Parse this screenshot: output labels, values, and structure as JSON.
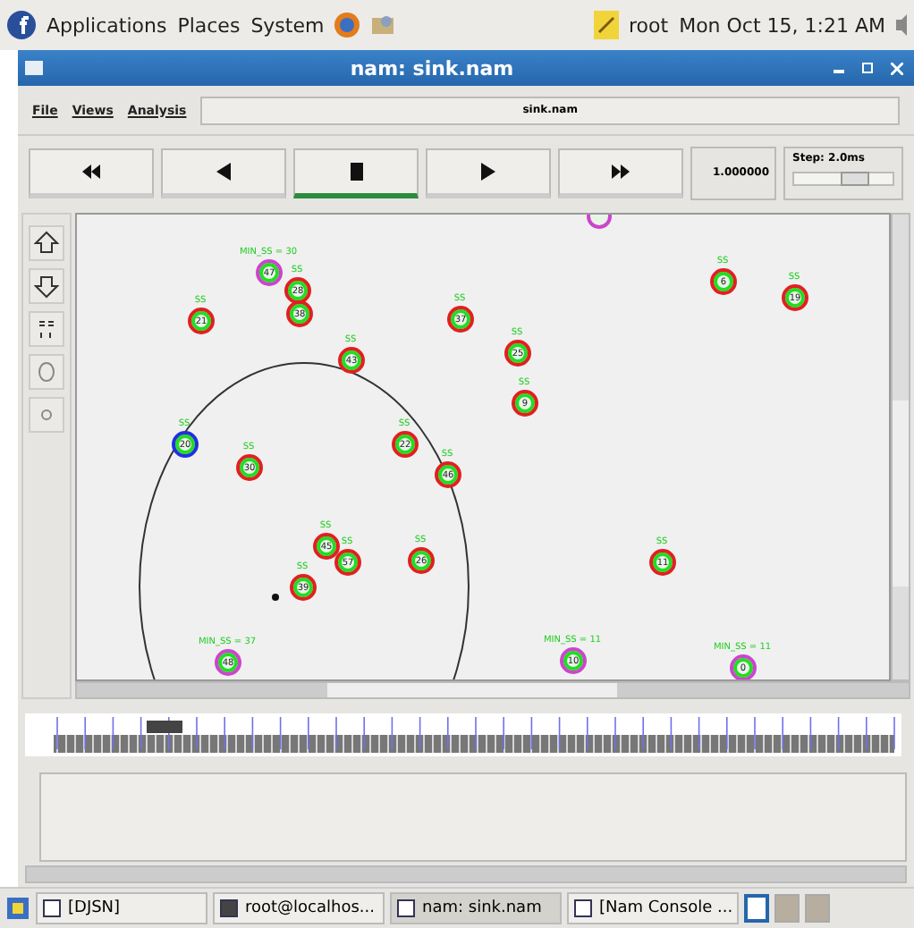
{
  "top_panel": {
    "menus": [
      "Applications",
      "Places",
      "System"
    ],
    "user": "root",
    "clock": "Mon Oct 15, 1:21 AM"
  },
  "window": {
    "title": "nam: sink.nam"
  },
  "menu": [
    "File",
    "Views",
    "Analysis"
  ],
  "file_field": "sink.nam",
  "controls": [
    {
      "kind": "rewind",
      "selected": false
    },
    {
      "kind": "back",
      "selected": false
    },
    {
      "kind": "stop",
      "selected": true
    },
    {
      "kind": "play",
      "selected": false
    },
    {
      "kind": "forward",
      "selected": false
    }
  ],
  "time": "1.000000",
  "step": {
    "label": "Step: 2.0ms",
    "level": 0.6
  },
  "nodes": [
    {
      "number": "47",
      "label": "MIN_SS = 30",
      "color": "#cc44cc"
    },
    {
      "number": "28",
      "label": "SS",
      "color": "#e02020"
    },
    {
      "number": "38",
      "color": "#e02020"
    },
    {
      "number": "21",
      "label": "SS",
      "color": "#e02020"
    },
    {
      "number": "43",
      "label": "SS",
      "color": "#e02020"
    },
    {
      "number": "37",
      "label": "SS",
      "color": "#e02020"
    },
    {
      "number": "25",
      "label": "SS",
      "color": "#e02020"
    },
    {
      "number": "9",
      "label": "SS",
      "color": "#e02020"
    },
    {
      "number": "6",
      "label": "SS",
      "color": "#e02020"
    },
    {
      "number": "19",
      "label": "SS",
      "color": "#e02020"
    },
    {
      "number": "20",
      "label": "SS",
      "color": "#2030e0"
    },
    {
      "number": "30",
      "label": "SS",
      "color": "#e02020"
    },
    {
      "number": "22",
      "label": "SS",
      "color": "#e02020"
    },
    {
      "number": "46",
      "label": "SS",
      "color": "#e02020"
    },
    {
      "number": "45",
      "label": "SS",
      "color": "#e02020"
    },
    {
      "number": "57",
      "label": "SS",
      "color": "#e02020"
    },
    {
      "number": "26",
      "label": "SS",
      "color": "#e02020"
    },
    {
      "number": "39",
      "label": "SS",
      "color": "#e02020"
    },
    {
      "number": "11",
      "label": "SS",
      "color": "#e02020"
    },
    {
      "number": "48",
      "label": "MIN_SS = 37",
      "color": "#cc44cc"
    },
    {
      "number": "10",
      "label": "MIN_SS = 11",
      "color": "#cc44cc"
    },
    {
      "number": "0",
      "label": "MIN_SS = 11",
      "color": "#cc44cc"
    }
  ],
  "taskbar": [
    {
      "label": "[DJSN]",
      "selected": false
    },
    {
      "label": "root@localhos...",
      "selected": false
    },
    {
      "label": "nam: sink.nam",
      "selected": true
    },
    {
      "label": "[Nam Console ...",
      "selected": false
    }
  ]
}
